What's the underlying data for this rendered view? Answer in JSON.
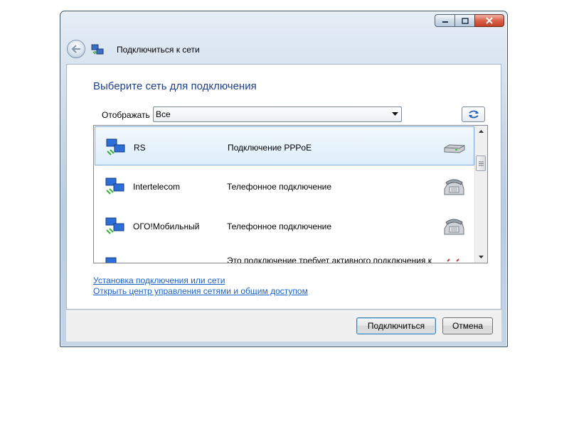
{
  "window": {
    "title": "Подключиться к сети"
  },
  "main": {
    "heading": "Выберите сеть для подключения",
    "filter_label": "Отображать",
    "filter_value": "Все"
  },
  "networks": [
    {
      "name": "RS",
      "type": "Подключение PPPoE",
      "device_icon": "modem-icon",
      "selected": true
    },
    {
      "name": "Intertelecom",
      "type": "Телефонное подключение",
      "device_icon": "phone-icon",
      "selected": false
    },
    {
      "name": "ОГО!Мобильный",
      "type": "Телефонное подключение",
      "device_icon": "phone-icon",
      "selected": false
    },
    {
      "name": "",
      "type": "Это подключение требует активного подключения к",
      "device_icon": "vpn-icon",
      "selected": false
    }
  ],
  "links": {
    "setup": "Установка подключения или сети",
    "network_center": "Открыть центр управления сетями и общим доступом"
  },
  "buttons": {
    "connect": "Подключиться",
    "cancel": "Отмена"
  },
  "colors": {
    "heading": "#1e3f8a",
    "link": "#1b61c6",
    "selection": "#ddeefb"
  }
}
